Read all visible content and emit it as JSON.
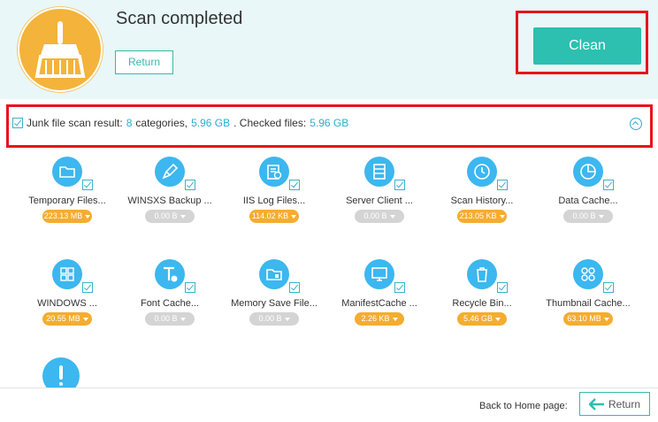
{
  "header": {
    "title": "Scan completed",
    "return_label": "Return",
    "clean_label": "Clean"
  },
  "summary": {
    "prefix": "Junk file scan result:",
    "categories_count": "8",
    "categories_word": "categories,",
    "total_size": "5.96 GB",
    "checked_label": ". Checked files:",
    "checked_size": "5.96 GB"
  },
  "items": [
    {
      "label": "Temporary Files...",
      "size": "223.13 MB",
      "state": "orange",
      "icon": "folder-icon"
    },
    {
      "label": "WINSXS Backup ...",
      "size": "0.00 B",
      "state": "gray",
      "icon": "brush-icon"
    },
    {
      "label": "IIS Log Files...",
      "size": "114.02 KB",
      "state": "orange",
      "icon": "log-file-icon"
    },
    {
      "label": "Server Client ...",
      "size": "0.00 B",
      "state": "gray",
      "icon": "server-icon"
    },
    {
      "label": "Scan History...",
      "size": "213.05 KB",
      "state": "orange",
      "icon": "clock-icon"
    },
    {
      "label": "Data Cache...",
      "size": "0.00 B",
      "state": "gray",
      "icon": "pie-chart-icon"
    },
    {
      "label": "WINDOWS ...",
      "size": "20.55 MB",
      "state": "orange",
      "icon": "windows-icon"
    },
    {
      "label": "Font Cache...",
      "size": "0.00 B",
      "state": "gray",
      "icon": "font-icon"
    },
    {
      "label": "Memory Save File...",
      "size": "0.00 B",
      "state": "gray",
      "icon": "memory-icon"
    },
    {
      "label": "ManifestCache ...",
      "size": "2.26 KB",
      "state": "orange",
      "icon": "monitor-icon"
    },
    {
      "label": "Recycle Bin...",
      "size": "5.46 GB",
      "state": "orange",
      "icon": "recycle-bin-icon"
    },
    {
      "label": "Thumbnail Cache...",
      "size": "63.10 MB",
      "state": "orange",
      "icon": "thumbnail-grid-icon"
    }
  ],
  "footer": {
    "back_home_text": "Back to Home page:",
    "return_label": "Return"
  },
  "colors": {
    "accent": "#2dbfb0",
    "orange": "#f4ad2f",
    "icon_blue": "#3cb7ef",
    "highlight": "#e8121b"
  }
}
